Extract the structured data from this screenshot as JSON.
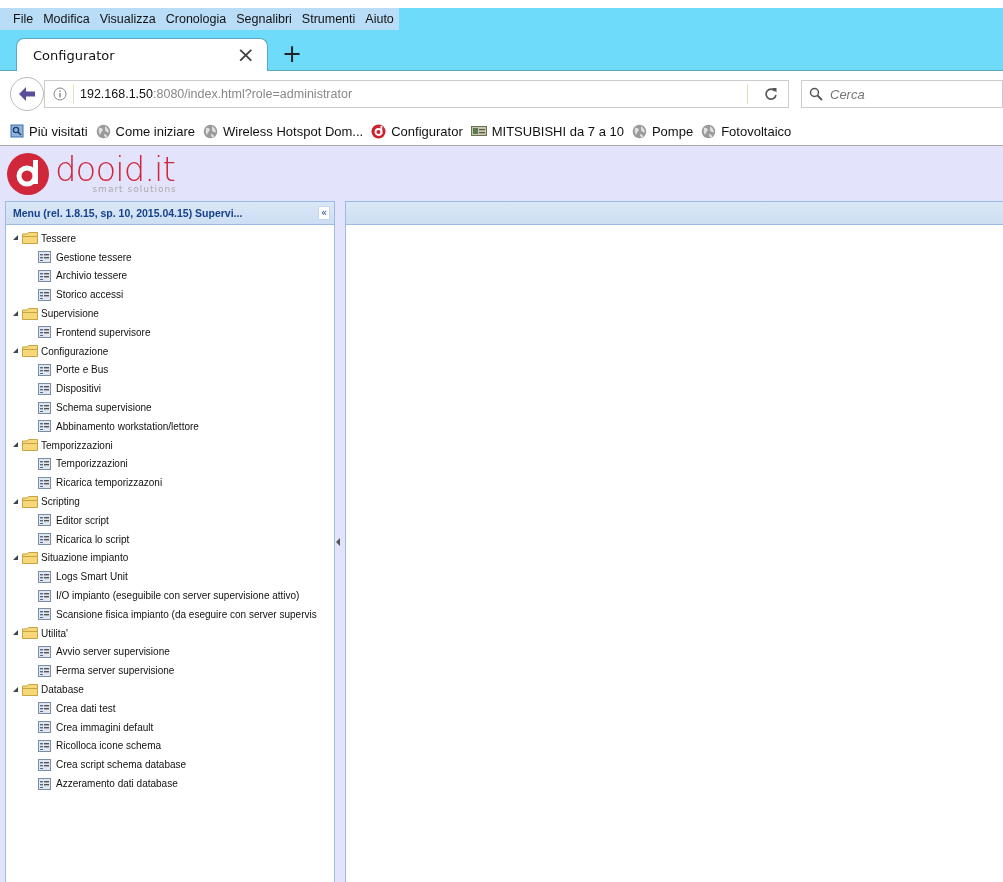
{
  "menu_bar": [
    "File",
    "Modifica",
    "Visualizza",
    "Cronologia",
    "Segnalibri",
    "Strumenti",
    "Aiuto"
  ],
  "tabs": [
    {
      "label": "Configurator",
      "selected": true,
      "close": "×"
    }
  ],
  "new_tab": "+",
  "address_bar": {
    "host": "192.168.1.50",
    "rest": ":8080/index.html?role=administrator"
  },
  "search": {
    "placeholder": "Cerca"
  },
  "bookmarks": [
    {
      "label": "Più visitati",
      "kind": "search"
    },
    {
      "label": "Come iniziare",
      "kind": "globe"
    },
    {
      "label": "Wireless Hotspot Dom...",
      "kind": "globe"
    },
    {
      "label": "Configurator",
      "kind": "brand"
    },
    {
      "label": "MITSUBISHI da 7 a 10",
      "kind": "card"
    },
    {
      "label": "Pompe",
      "kind": "globe"
    },
    {
      "label": "Fotovoltaico",
      "kind": "globe"
    }
  ],
  "logo": {
    "name": "dooid.it",
    "tagline": "smart solutions"
  },
  "menu_panel": {
    "title": "Menu (rel. 1.8.15, sp. 10, 2015.04.15) Supervi...",
    "collapse": "«",
    "tree": [
      {
        "label": "Tessere",
        "expanded": true,
        "children": [
          {
            "label": "Gestione tessere"
          },
          {
            "label": "Archivio tessere"
          },
          {
            "label": "Storico accessi"
          }
        ]
      },
      {
        "label": "Supervisione",
        "expanded": true,
        "children": [
          {
            "label": "Frontend supervisore"
          }
        ]
      },
      {
        "label": "Configurazione",
        "expanded": true,
        "children": [
          {
            "label": "Porte e Bus"
          },
          {
            "label": "Dispositivi"
          },
          {
            "label": "Schema supervisione"
          },
          {
            "label": "Abbinamento workstation/lettore"
          }
        ]
      },
      {
        "label": "Temporizzazioni",
        "expanded": true,
        "children": [
          {
            "label": "Temporizzazioni"
          },
          {
            "label": "Ricarica temporizzazoni"
          }
        ]
      },
      {
        "label": "Scripting",
        "expanded": true,
        "children": [
          {
            "label": "Editor script"
          },
          {
            "label": "Ricarica lo script"
          }
        ]
      },
      {
        "label": "Situazione impianto",
        "expanded": true,
        "children": [
          {
            "label": "Logs Smart Unit"
          },
          {
            "label": "I/O impianto (eseguibile con server supervisione attivo)"
          },
          {
            "label": "Scansione fisica impianto (da eseguire con server supervis"
          }
        ]
      },
      {
        "label": "Utilita'",
        "expanded": true,
        "children": [
          {
            "label": "Avvio server supervisione"
          },
          {
            "label": "Ferma server supervisione"
          }
        ]
      },
      {
        "label": "Database",
        "expanded": true,
        "children": [
          {
            "label": "Crea dati test"
          },
          {
            "label": "Crea immagini default"
          },
          {
            "label": "Ricolloca icone schema"
          },
          {
            "label": "Crea script schema database"
          },
          {
            "label": "Azzeramento dati database"
          }
        ]
      }
    ]
  }
}
